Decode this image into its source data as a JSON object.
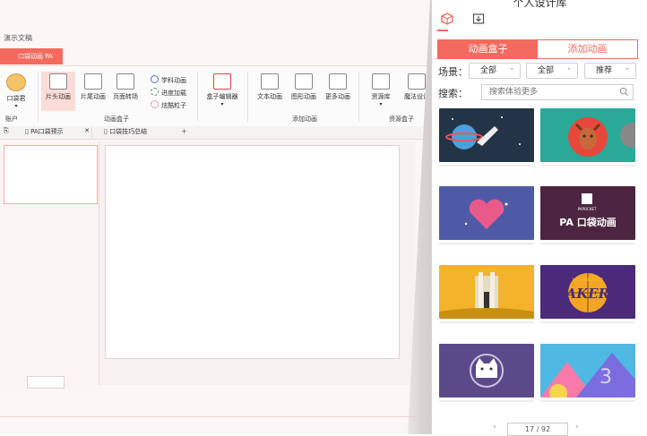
{
  "window": {
    "doc_title": "演示文稿",
    "plugin_tab": "口袋动画 PA"
  },
  "ribbon": {
    "account": {
      "label": "口袋君",
      "group": "账户"
    },
    "intro_anim": "片头动画",
    "outro_anim": "片尾动画",
    "page_transition": "页面转场",
    "subject_anim": "学科动画",
    "progress_load": "进度加载",
    "cool_particles": "炫酷粒子",
    "group_anim_box": "动画盒子",
    "box_editor": "盒子编辑器",
    "text_anim": "文本动画",
    "shape_anim": "图形动画",
    "more_anim": "更多动画",
    "group_add_anim": "添加动画",
    "resource_lib": "资源库",
    "magic_design": "魔法设计",
    "group_resource_box": "资源盒子"
  },
  "doc_tabs": [
    {
      "label": "PA口袋预示"
    },
    {
      "label": "口袋技巧总结"
    }
  ],
  "panel": {
    "title": "个人设计库",
    "tabs": {
      "active": "动画盒子",
      "inactive": "添加动画"
    },
    "scene_label": "场景：",
    "filter1": "全部",
    "filter2": "全部",
    "filter3": "推荐",
    "search_label": "搜索：",
    "search_placeholder": "搜索体验更多",
    "cards": [
      {
        "title": ""
      },
      {
        "title": ""
      },
      {
        "title": "PA 口袋动画",
        "brand": "PAPOCKET"
      },
      {
        "title": ""
      },
      {
        "title": "LAKERS",
        "sub": "LOS ANGELES"
      },
      {
        "title": ""
      },
      {
        "title": ""
      },
      {
        "title": ""
      }
    ],
    "pager": {
      "current": "17",
      "total": "92",
      "sep": "/"
    }
  },
  "colors": {
    "accent": "#f46a5e",
    "accent_light": "#fbdcd8"
  }
}
